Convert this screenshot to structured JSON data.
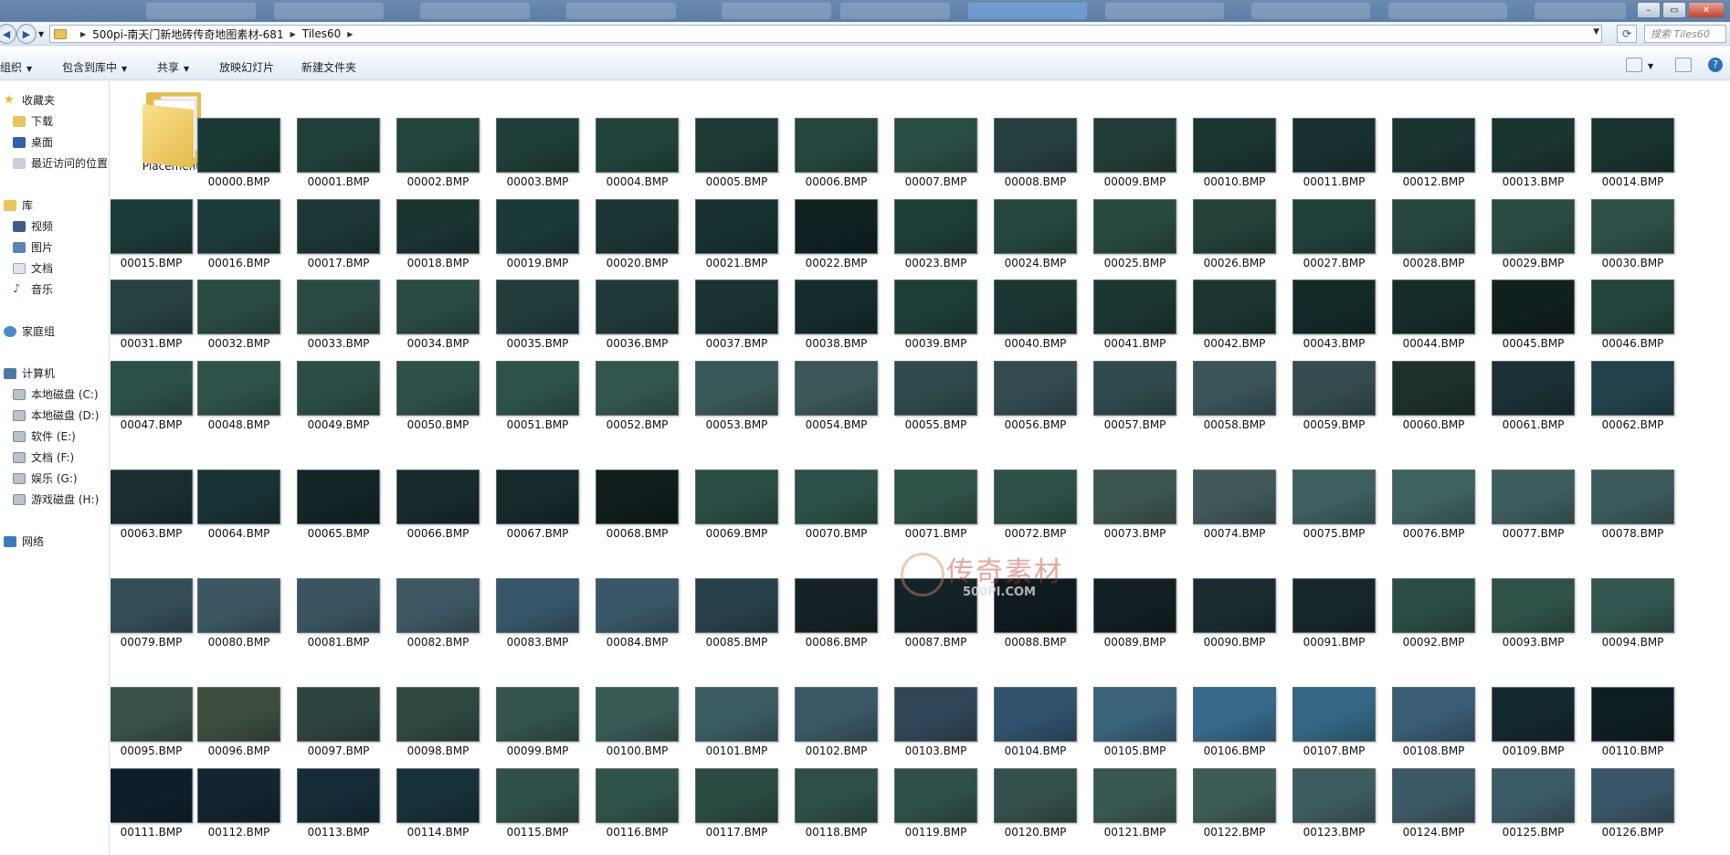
{
  "address_bar": {
    "breadcrumbs": [
      "500pi-南天门新地砖传奇地图素材-681",
      "Tiles60"
    ],
    "search_placeholder": "搜索 Tiles60"
  },
  "toolbar": {
    "organize": "组织",
    "include_in_library": "包含到库中",
    "share": "共享",
    "slideshow": "放映幻灯片",
    "new_folder": "新建文件夹"
  },
  "nav": {
    "favorites": "收藏夹",
    "downloads": "下载",
    "desktop": "桌面",
    "recent": "最近访问的位置",
    "libraries": "库",
    "videos": "视频",
    "pictures": "图片",
    "documents": "文档",
    "music": "音乐",
    "homegroup": "家庭组",
    "computer": "计算机",
    "drives": [
      "本地磁盘 (C:)",
      "本地磁盘 (D:)",
      "软件 (E:)",
      "文档 (F:)",
      "娱乐 (G:)",
      "游戏磁盘 (H:)"
    ],
    "network": "网络"
  },
  "folder": {
    "name": "Placements"
  },
  "files": [
    "00000.BMP",
    "00001.BMP",
    "00002.BMP",
    "00003.BMP",
    "00004.BMP",
    "00005.BMP",
    "00006.BMP",
    "00007.BMP",
    "00008.BMP",
    "00009.BMP",
    "00010.BMP",
    "00011.BMP",
    "00012.BMP",
    "00013.BMP",
    "00014.BMP",
    "00015.BMP",
    "00016.BMP",
    "00017.BMP",
    "00018.BMP",
    "00019.BMP",
    "00020.BMP",
    "00021.BMP",
    "00022.BMP",
    "00023.BMP",
    "00024.BMP",
    "00025.BMP",
    "00026.BMP",
    "00027.BMP",
    "00028.BMP",
    "00029.BMP",
    "00030.BMP",
    "00031.BMP",
    "00032.BMP",
    "00033.BMP",
    "00034.BMP",
    "00035.BMP",
    "00036.BMP",
    "00037.BMP",
    "00038.BMP",
    "00039.BMP",
    "00040.BMP",
    "00041.BMP",
    "00042.BMP",
    "00043.BMP",
    "00044.BMP",
    "00045.BMP",
    "00046.BMP",
    "00047.BMP",
    "00048.BMP",
    "00049.BMP",
    "00050.BMP",
    "00051.BMP",
    "00052.BMP",
    "00053.BMP",
    "00054.BMP",
    "00055.BMP",
    "00056.BMP",
    "00057.BMP",
    "00058.BMP",
    "00059.BMP",
    "00060.BMP",
    "00061.BMP",
    "00062.BMP",
    "00063.BMP",
    "00064.BMP",
    "00065.BMP",
    "00066.BMP",
    "00067.BMP",
    "00068.BMP",
    "00069.BMP",
    "00070.BMP",
    "00071.BMP",
    "00072.BMP",
    "00073.BMP",
    "00074.BMP",
    "00075.BMP",
    "00076.BMP",
    "00077.BMP",
    "00078.BMP",
    "00079.BMP",
    "00080.BMP",
    "00081.BMP",
    "00082.BMP",
    "00083.BMP",
    "00084.BMP",
    "00085.BMP",
    "00086.BMP",
    "00087.BMP",
    "00088.BMP",
    "00089.BMP",
    "00090.BMP",
    "00091.BMP",
    "00092.BMP",
    "00093.BMP",
    "00094.BMP",
    "00095.BMP",
    "00096.BMP",
    "00097.BMP",
    "00098.BMP",
    "00099.BMP",
    "00100.BMP",
    "00101.BMP",
    "00102.BMP",
    "00103.BMP",
    "00104.BMP",
    "00105.BMP",
    "00106.BMP",
    "00107.BMP",
    "00108.BMP",
    "00109.BMP",
    "00110.BMP",
    "00111.BMP",
    "00112.BMP",
    "00113.BMP",
    "00114.BMP",
    "00115.BMP",
    "00116.BMP",
    "00117.BMP",
    "00118.BMP",
    "00119.BMP",
    "00120.BMP",
    "00121.BMP",
    "00122.BMP",
    "00123.BMP",
    "00124.BMP",
    "00125.BMP",
    "00126.BMP"
  ],
  "thumb_colors": [
    "#1b3a36",
    "#21403b",
    "#24453f",
    "#1f3d38",
    "#22433d",
    "#1e3b37",
    "#25463f",
    "#2a4d45",
    "#263f40",
    "#223d39",
    "#1a3532",
    "#183130",
    "#1a3432",
    "#1a3432",
    "#193330",
    "#1c3a37",
    "#1d3b3a",
    "#1c3735",
    "#1a3432",
    "#1c393a",
    "#1b3634",
    "#173131",
    "#0f2222",
    "#1f3d37",
    "#25463e",
    "#28493f",
    "#234039",
    "#21403b",
    "#27463f",
    "#2a4b43",
    "#2e4f48",
    "#26413f",
    "#2a4a43",
    "#2c4a45",
    "#2a4a43",
    "#213c3b",
    "#1f3a38",
    "#1a3232",
    "#152b2c",
    "#1f3d38",
    "#1b3633",
    "#1c3633",
    "#1c3532",
    "#142a28",
    "#162c2a",
    "#10201f",
    "#24443e",
    "#2c5048",
    "#2e5149",
    "#2b4d45",
    "#2e5049",
    "#2e514c",
    "#335550",
    "#3a5958",
    "#3b5758",
    "#2f4a4c",
    "#334b4f",
    "#2f4a4c",
    "#3a5458",
    "#354b4e",
    "#1e3029",
    "#1b3034",
    "#23424b",
    "#1a2e30",
    "#183235",
    "#132527",
    "#172a2c",
    "#16292b",
    "#0f1d1d",
    "#2b4d45",
    "#2c5049",
    "#2f5249",
    "#2e5049",
    "#3b5550",
    "#40585a",
    "#3f5f61",
    "#3e6260",
    "#3e5d5f",
    "#3d5a5d",
    "#344e58",
    "#3c5762",
    "#3a5560",
    "#3d5863",
    "#37566b",
    "#395767",
    "#28404a",
    "#152326",
    "#142328",
    "#0f1b1f",
    "#121f23",
    "#1a2c30",
    "#17282c",
    "#2b4d45",
    "#2f5249",
    "#325550",
    "#38524a",
    "#3c4d3e",
    "#2e4441",
    "#2f4842",
    "#33534c",
    "#395a55",
    "#3b5d62",
    "#3a5866",
    "#30475a",
    "#30526c",
    "#3a627a",
    "#37698a",
    "#346783",
    "#3a5c74",
    "#14282f",
    "#0f1e22",
    "#0f1f2a",
    "#132530",
    "#152b38",
    "#17313a",
    "#2f5048",
    "#2f534b",
    "#2b4b43",
    "#2e4f48",
    "#2f5049",
    "#34504d",
    "#3a5853",
    "#3d5c58",
    "#3e5d60",
    "#3c5a66",
    "#3c5b68",
    "#3a5567"
  ]
}
